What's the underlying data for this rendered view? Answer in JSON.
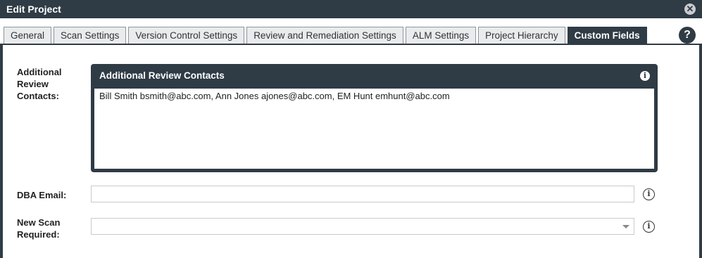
{
  "window": {
    "title": "Edit Project",
    "close_icon": "close-icon"
  },
  "tabs": [
    {
      "label": "General",
      "active": false
    },
    {
      "label": "Scan Settings",
      "active": false
    },
    {
      "label": "Version Control Settings",
      "active": false
    },
    {
      "label": "Review and Remediation Settings",
      "active": false
    },
    {
      "label": "ALM Settings",
      "active": false
    },
    {
      "label": "Project Hierarchy",
      "active": false
    },
    {
      "label": "Custom Fields",
      "active": true
    }
  ],
  "help": {
    "symbol": "?"
  },
  "fields": {
    "additional_review_contacts": {
      "label_lines": [
        "Additional",
        "Review",
        "Contacts:"
      ],
      "panel_title": "Additional Review Contacts",
      "info_symbol": "i",
      "value": "Bill Smith bsmith@abc.com, Ann Jones ajones@abc.com, EM Hunt emhunt@abc.com"
    },
    "dba_email": {
      "label": "DBA Email:",
      "value": "",
      "info_symbol": "i"
    },
    "new_scan_required": {
      "label_lines": [
        "New Scan",
        "Required:"
      ],
      "value": "",
      "info_symbol": "i"
    }
  },
  "colors": {
    "dark": "#2f3b45",
    "tab_bg": "#e9ebed",
    "border": "#c7cacd"
  }
}
